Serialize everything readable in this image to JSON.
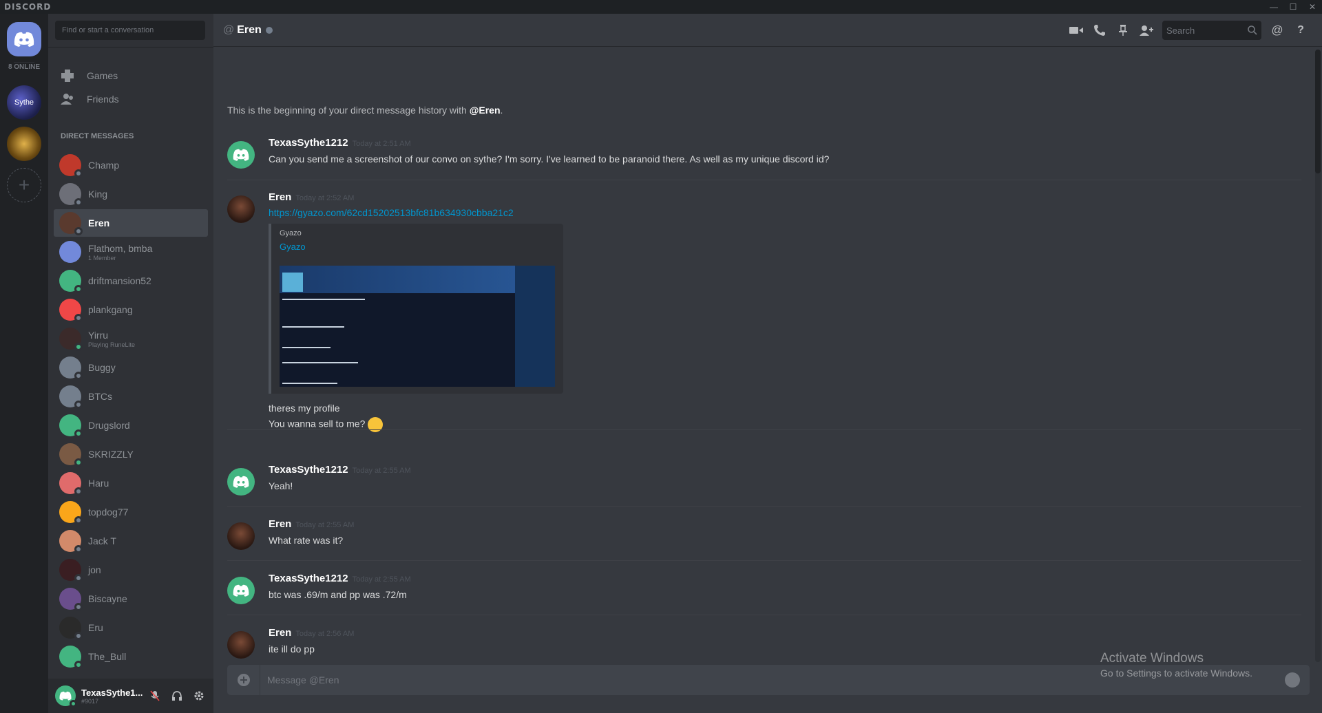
{
  "app": {
    "brand": "DISCORD",
    "window_controls": [
      "—",
      "☐",
      "✕"
    ]
  },
  "guilds": {
    "online_count": "8 ONLINE",
    "server_label": "Sythe"
  },
  "sidebar": {
    "search_placeholder": "Find or start a conversation",
    "nav": [
      {
        "label": "Games"
      },
      {
        "label": "Friends"
      }
    ],
    "dm_header": "DIRECT MESSAGES",
    "dms": [
      {
        "name": "Champ",
        "color": "#c0392b",
        "status": "offline"
      },
      {
        "name": "King",
        "color": "#6d6f78",
        "status": "offline"
      },
      {
        "name": "Eren",
        "color": "#5a3a2e",
        "status": "offline",
        "active": true
      },
      {
        "name": "Flathom, bmba",
        "sub": "1 Member",
        "color": "#7289da",
        "status": "group"
      },
      {
        "name": "driftmansion52",
        "color": "#43b581",
        "status": "online"
      },
      {
        "name": "plankgang",
        "color": "#f04747",
        "status": "offline"
      },
      {
        "name": "Yirru",
        "sub": "Playing RuneLite",
        "color": "#3b2a2a",
        "status": "online"
      },
      {
        "name": "Buggy",
        "color": "#747f8d",
        "status": "offline"
      },
      {
        "name": "BTCs",
        "color": "#747f8d",
        "status": "offline"
      },
      {
        "name": "Drugslord",
        "color": "#43b581",
        "status": "online"
      },
      {
        "name": "SKRIZZLY",
        "color": "#7a5a44",
        "status": "online"
      },
      {
        "name": "Haru",
        "color": "#e06b6b",
        "status": "offline"
      },
      {
        "name": "topdog77",
        "color": "#faa61a",
        "status": "offline"
      },
      {
        "name": "Jack T",
        "color": "#d28a6a",
        "status": "offline"
      },
      {
        "name": "jon",
        "color": "#3a1e22",
        "status": "offline"
      },
      {
        "name": "Biscayne",
        "color": "#6a4e8c",
        "status": "offline"
      },
      {
        "name": "Eru",
        "color": "#2a2a2a",
        "status": "offline"
      },
      {
        "name": "The_Bull",
        "color": "#43b581",
        "status": "online"
      }
    ]
  },
  "user": {
    "name": "TexasSythe1...",
    "tag": "#9017"
  },
  "chat": {
    "at": "@",
    "title": "Eren",
    "search_placeholder": "Search",
    "intro_prefix": "This is the beginning of your direct message history with ",
    "intro_user": "@Eren",
    "intro_suffix": ".",
    "messages": [
      {
        "author": "TexasSythe1212",
        "time": "Today at 2:51 AM",
        "lines": [
          "Can you send me a screenshot of our convo on sythe? I'm sorry. I've learned to be paranoid there. As well as my unique discord id?"
        ]
      },
      {
        "author": "Eren",
        "time": "Today at 2:52 AM",
        "link": "https://gyazo.com/62cd15202513bfc81b634930cbba21c2",
        "embed_provider": "Gyazo",
        "embed_title": "Gyazo",
        "lines": [
          "theres my profile",
          "You wanna sell to me?"
        ]
      },
      {
        "author": "TexasSythe1212",
        "time": "Today at 2:55 AM",
        "lines": [
          "Yeah!"
        ]
      },
      {
        "author": "Eren",
        "time": "Today at 2:55 AM",
        "lines": [
          "What rate was it?"
        ]
      },
      {
        "author": "TexasSythe1212",
        "time": "Today at 2:55 AM",
        "lines": [
          "btc was .69/m and pp was .72/m"
        ]
      },
      {
        "author": "Eren",
        "time": "Today at 2:56 AM",
        "lines": [
          "ite ill do pp"
        ]
      }
    ],
    "composer_placeholder": "Message @Eren"
  },
  "watermark": {
    "line1": "Activate Windows",
    "line2": "Go to Settings to activate Windows."
  }
}
